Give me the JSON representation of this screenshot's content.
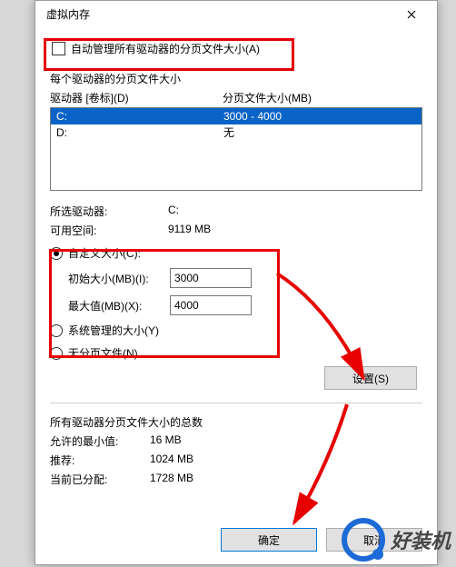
{
  "dialog": {
    "title": "虚拟内存",
    "auto_manage_label": "自动管理所有驱动器的分页文件大小(A)",
    "each_drive_title": "每个驱动器的分页文件大小",
    "col_drive": "驱动器 [卷标](D)",
    "col_size": "分页文件大小(MB)",
    "drives": [
      {
        "letter": "C:",
        "size": "3000 - 4000",
        "selected": true
      },
      {
        "letter": "D:",
        "size": "无",
        "selected": false
      }
    ],
    "selected_drive_label": "所选驱动器:",
    "selected_drive_value": "C:",
    "free_space_label": "可用空间:",
    "free_space_value": "9119 MB",
    "radio_custom": "自定义大小(C):",
    "initial_label": "初始大小(MB)(I):",
    "initial_value": "3000",
    "max_label": "最大值(MB)(X):",
    "max_value": "4000",
    "radio_system": "系统管理的大小(Y)",
    "radio_none": "无分页文件(N)",
    "set_btn": "设置(S)",
    "totals_title": "所有驱动器分页文件大小的总数",
    "min_allowed_label": "允许的最小值:",
    "min_allowed_value": "16 MB",
    "recommended_label": "推荐:",
    "recommended_value": "1024 MB",
    "current_label": "当前已分配:",
    "current_value": "1728 MB",
    "ok_btn": "确定",
    "cancel_btn": "取消"
  },
  "watermark": "好装机"
}
